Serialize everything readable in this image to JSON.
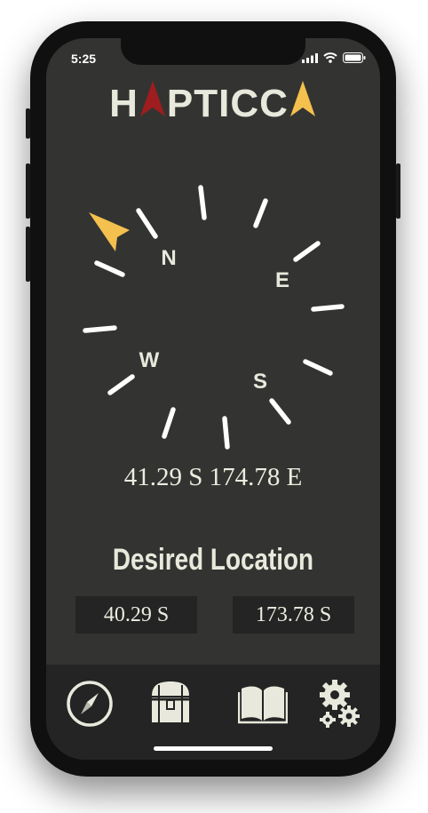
{
  "status": {
    "time": "5:25",
    "icons": [
      "signal-icon",
      "wifi-icon",
      "battery-icon"
    ]
  },
  "app": {
    "logo": {
      "prefix": "H",
      "a_glyph": "A",
      "middle": "PTIC",
      "suffix": "C",
      "last_glyph": "A"
    },
    "colors": {
      "background": "#333431",
      "accent_yellow": "#f4c04e",
      "accent_red": "#9e1d1f",
      "text": "#e8e9dc"
    }
  },
  "compass": {
    "labels": {
      "north": "N",
      "east": "E",
      "south": "S",
      "west": "W"
    },
    "pointer": "arrow-pointer-icon"
  },
  "current_location": {
    "text": "41.29 S 174.78 E"
  },
  "desired_location": {
    "title": "Desired Location",
    "latitude": "40.29 S",
    "longitude": "173.78 S"
  },
  "tabbar": {
    "items": [
      {
        "name": "compass-icon"
      },
      {
        "name": "treasure-chest-icon"
      },
      {
        "name": "book-icon"
      },
      {
        "name": "gears-icon"
      }
    ]
  }
}
